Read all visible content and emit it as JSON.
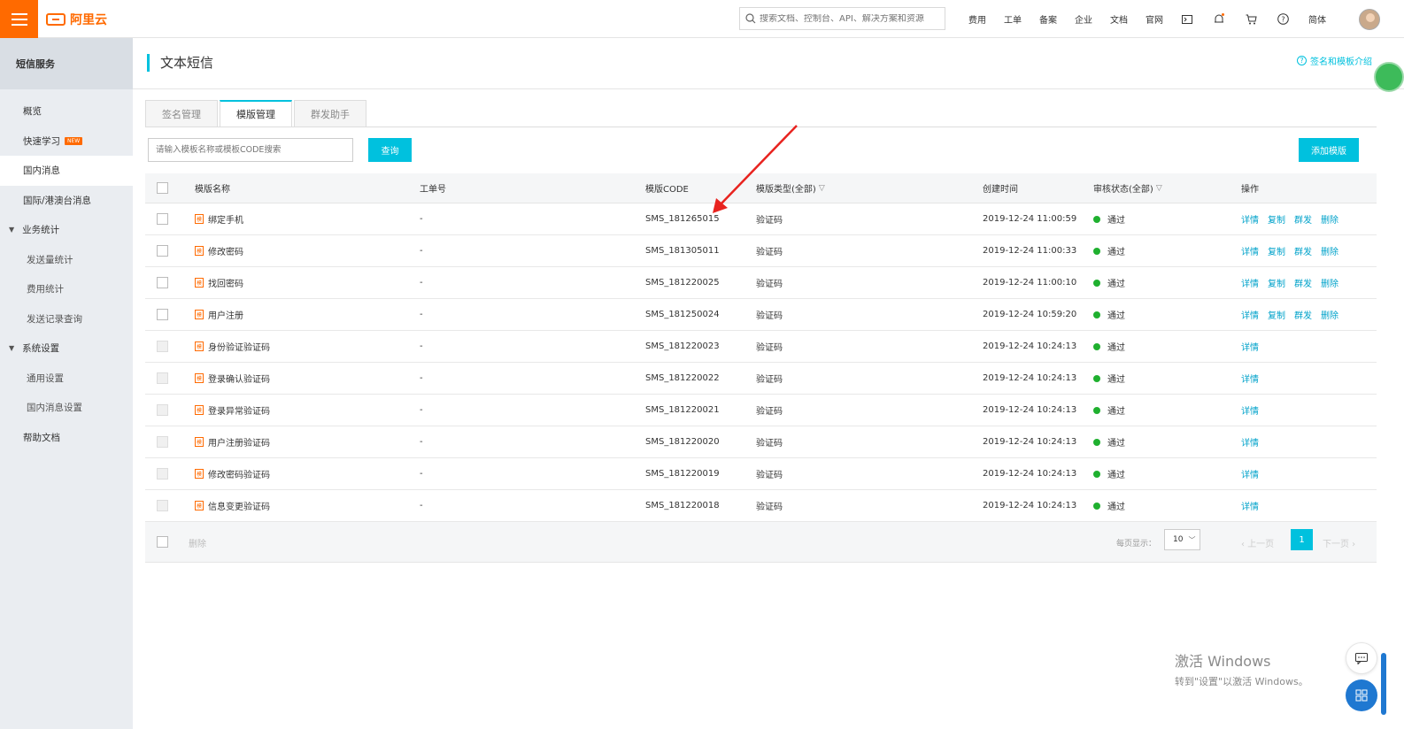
{
  "topbar": {
    "logo_text": "阿里云",
    "search_placeholder": "搜索文档、控制台、API、解决方案和资源",
    "nav": [
      "费用",
      "工单",
      "备案",
      "企业",
      "文档",
      "官网"
    ],
    "lang": "简体"
  },
  "sidebar": {
    "title": "短信服务",
    "items": [
      {
        "label": "概览",
        "type": "item"
      },
      {
        "label": "快速学习",
        "type": "item",
        "badge": "NEW"
      },
      {
        "label": "国内消息",
        "type": "item",
        "active": true
      },
      {
        "label": "国际/港澳台消息",
        "type": "item"
      },
      {
        "label": "业务统计",
        "type": "group"
      },
      {
        "label": "发送量统计",
        "type": "sub"
      },
      {
        "label": "费用统计",
        "type": "sub"
      },
      {
        "label": "发送记录查询",
        "type": "sub"
      },
      {
        "label": "系统设置",
        "type": "group"
      },
      {
        "label": "通用设置",
        "type": "sub"
      },
      {
        "label": "国内消息设置",
        "type": "sub"
      },
      {
        "label": "帮助文档",
        "type": "item"
      }
    ]
  },
  "header": {
    "title": "文本短信",
    "help_link": "签名和模板介绍"
  },
  "tabs": [
    "签名管理",
    "模版管理",
    "群发助手"
  ],
  "toolbar": {
    "search_placeholder": "请输入模板名称或模板CODE搜索",
    "search_btn": "查询",
    "add_btn": "添加模版"
  },
  "table": {
    "columns": {
      "name": "模版名称",
      "ticket": "工单号",
      "code": "模版CODE",
      "type": "模版类型(全部)",
      "time": "创建时间",
      "status": "审核状态(全部)",
      "ops": "操作"
    },
    "rows": [
      {
        "name": "绑定手机",
        "ticket": "-",
        "code": "SMS_181265015",
        "type": "验证码",
        "time": "2019-12-24 11:00:59",
        "status": "通过",
        "ops": [
          "详情",
          "复制",
          "群发",
          "删除"
        ],
        "disabled": false
      },
      {
        "name": "修改密码",
        "ticket": "-",
        "code": "SMS_181305011",
        "type": "验证码",
        "time": "2019-12-24 11:00:33",
        "status": "通过",
        "ops": [
          "详情",
          "复制",
          "群发",
          "删除"
        ],
        "disabled": false
      },
      {
        "name": "找回密码",
        "ticket": "-",
        "code": "SMS_181220025",
        "type": "验证码",
        "time": "2019-12-24 11:00:10",
        "status": "通过",
        "ops": [
          "详情",
          "复制",
          "群发",
          "删除"
        ],
        "disabled": false
      },
      {
        "name": "用户注册",
        "ticket": "-",
        "code": "SMS_181250024",
        "type": "验证码",
        "time": "2019-12-24 10:59:20",
        "status": "通过",
        "ops": [
          "详情",
          "复制",
          "群发",
          "删除"
        ],
        "disabled": false
      },
      {
        "name": "身份验证验证码",
        "ticket": "-",
        "code": "SMS_181220023",
        "type": "验证码",
        "time": "2019-12-24 10:24:13",
        "status": "通过",
        "ops": [
          "详情"
        ],
        "disabled": true
      },
      {
        "name": "登录确认验证码",
        "ticket": "-",
        "code": "SMS_181220022",
        "type": "验证码",
        "time": "2019-12-24 10:24:13",
        "status": "通过",
        "ops": [
          "详情"
        ],
        "disabled": true
      },
      {
        "name": "登录异常验证码",
        "ticket": "-",
        "code": "SMS_181220021",
        "type": "验证码",
        "time": "2019-12-24 10:24:13",
        "status": "通过",
        "ops": [
          "详情"
        ],
        "disabled": true
      },
      {
        "name": "用户注册验证码",
        "ticket": "-",
        "code": "SMS_181220020",
        "type": "验证码",
        "time": "2019-12-24 10:24:13",
        "status": "通过",
        "ops": [
          "详情"
        ],
        "disabled": true
      },
      {
        "name": "修改密码验证码",
        "ticket": "-",
        "code": "SMS_181220019",
        "type": "验证码",
        "time": "2019-12-24 10:24:13",
        "status": "通过",
        "ops": [
          "详情"
        ],
        "disabled": true
      },
      {
        "name": "信息变更验证码",
        "ticket": "-",
        "code": "SMS_181220018",
        "type": "验证码",
        "time": "2019-12-24 10:24:13",
        "status": "通过",
        "ops": [
          "详情"
        ],
        "disabled": true
      }
    ],
    "template_icon": "模",
    "footer": {
      "delete": "删除",
      "page_size_label": "每页显示：",
      "page_size": "10",
      "prev": "上一页",
      "current_page": "1",
      "next": "下一页"
    }
  },
  "watermark": {
    "line1": "激活 Windows",
    "line2": "转到\"设置\"以激活 Windows。"
  },
  "colors": {
    "brand": "#ff6a00",
    "accent": "#00c1de",
    "status_ok": "#1fb02f",
    "annotation_arrow": "#e8231f"
  }
}
